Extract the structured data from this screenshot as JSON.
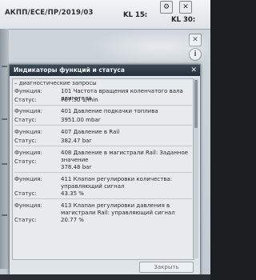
{
  "header": {
    "breadcrumb": "АКПП/ЕСЕ/ПР/2019/03",
    "kl15_label": "KL 15:",
    "kl15_value": "–",
    "kl30_label": "KL 30:",
    "kl30_value": "–"
  },
  "icons": {
    "gear": "⚙",
    "close": "✕",
    "info": "i"
  },
  "dialog": {
    "title": "Индикаторы функций и статуса",
    "close_label": "✕",
    "group_header": "– диагностические запросы",
    "items": [
      {
        "func_label": "Функция:",
        "func": "101 Частота вращения коленчатого вала двигателя",
        "status_label": "Статус:",
        "status": "707.50  1/min"
      },
      {
        "func_label": "Функция:",
        "func": "401 Давление подкачки топлива",
        "status_label": "Статус:",
        "status": "3951.00  mbar"
      },
      {
        "func_label": "Функция:",
        "func": "407 Давление в Rail",
        "status_label": "Статус:",
        "status": "382.47  bar"
      },
      {
        "func_label": "Функция:",
        "func": "408 Давление в магистрали Rail: Заданное значение",
        "status_label": "Статус:",
        "status": "378.48  bar"
      },
      {
        "func_label": "Функция:",
        "func": "411 Клапан регулировки количества: управляющий сигнал",
        "status_label": "Статус:",
        "status": "43.35  %"
      },
      {
        "func_label": "Функция:",
        "func": "413 Клапан регулировки давления в магистрали Rail: управляющий сигнал",
        "status_label": "Статус:",
        "status": "20.77  %"
      }
    ],
    "footer_button": "Закрыть"
  }
}
